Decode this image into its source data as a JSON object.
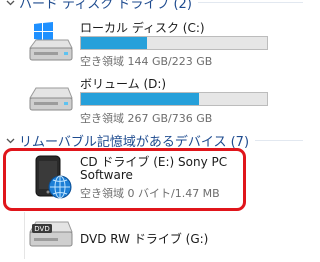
{
  "groups": {
    "hard_disk": {
      "title": "ハード ディスク ドライブ (2)"
    },
    "removable": {
      "title": "リムーバブル記憶域があるデバイス (7)"
    }
  },
  "drives": [
    {
      "name": "ローカル ディスク (C:)",
      "free_text": "空き領域 144 GB/223 GB",
      "used_fraction": 0.354,
      "icon": "windows-drive-icon"
    },
    {
      "name": "ボリューム (D:)",
      "free_text": "空き領域 267 GB/736 GB",
      "used_fraction": 0.637,
      "icon": "hard-drive-icon"
    },
    {
      "name_line1": "CD ドライブ (E:) Sony PC",
      "name_line2": "Software",
      "free_text": "空き領域 0 バイト/1.47 MB",
      "icon": "phone-globe-icon"
    },
    {
      "name": "DVD RW ドライブ (G:)",
      "icon": "dvd-drive-icon",
      "icon_label": "DVD"
    }
  ],
  "colors": {
    "bar_fill": "#26a0da",
    "highlight": "#e0151b",
    "header_text": "#1e4b8f"
  }
}
